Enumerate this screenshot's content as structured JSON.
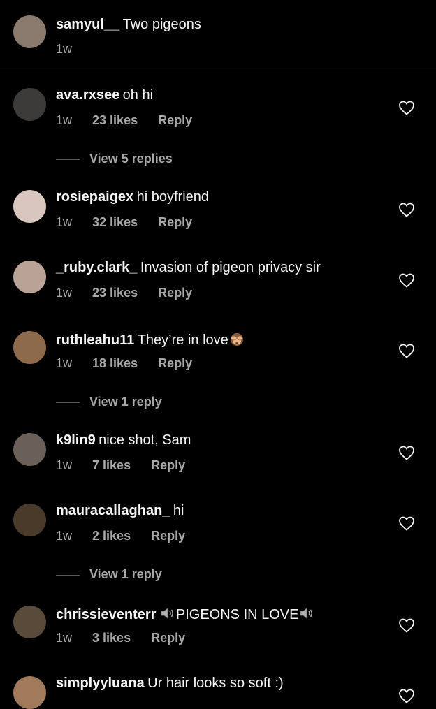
{
  "caption": {
    "username": "samyul__",
    "text": "Two pigeons",
    "time": "1w",
    "avatar_color": "#8a7a6e"
  },
  "comments": [
    {
      "username": "ava.rxsee",
      "text": "oh hi",
      "time": "1w",
      "likes": "23 likes",
      "reply": "Reply",
      "view_replies": "View 5 replies",
      "avatar_color": "#3d3a3a"
    },
    {
      "username": "rosiepaigex",
      "text": "hi boyfriend",
      "time": "1w",
      "likes": "32 likes",
      "reply": "Reply",
      "avatar_color": "#d9c7bf"
    },
    {
      "username": "_ruby.clark_",
      "text": "Invasion of pigeon privacy sir",
      "time": "1w",
      "likes": "23 likes",
      "reply": "Reply",
      "avatar_color": "#b8a396"
    },
    {
      "username": "ruthleahu11",
      "text": "They’re in love",
      "emoji": "see-no-evil-monkey",
      "time": "1w",
      "likes": "18 likes",
      "reply": "Reply",
      "view_replies": "View 1 reply",
      "avatar_color": "#8c6a4b"
    },
    {
      "username": "k9lin9",
      "text": "nice shot, Sam",
      "time": "1w",
      "likes": "7 likes",
      "reply": "Reply",
      "avatar_color": "#6b5f5a"
    },
    {
      "username": "mauracallaghan_",
      "text": "hi",
      "time": "1w",
      "likes": "2 likes",
      "reply": "Reply",
      "view_replies": "View 1 reply",
      "avatar_color": "#4a3a2a"
    },
    {
      "username": "chrissieventerr",
      "text": "PIGEONS IN LOVE",
      "emoji": "speaker-loud",
      "time": "1w",
      "likes": "3 likes",
      "reply": "Reply",
      "avatar_color": "#5a4a3a"
    },
    {
      "username": "simplyyluana",
      "text": "Ur hair looks so soft :)",
      "avatar_color": "#a07a5a"
    }
  ]
}
